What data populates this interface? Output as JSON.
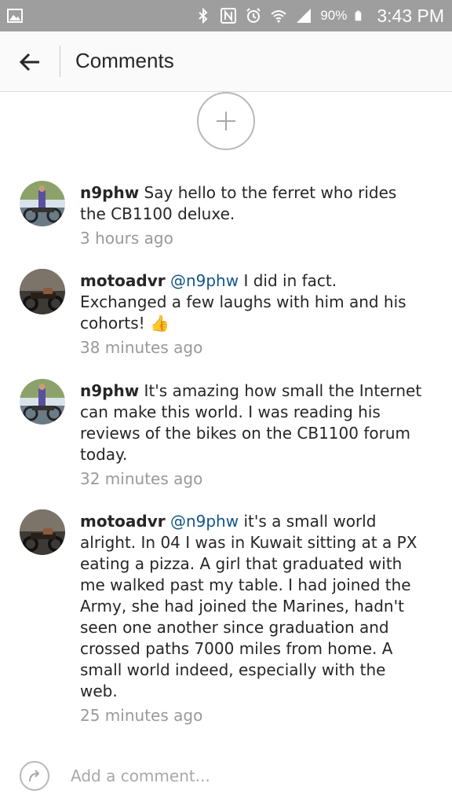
{
  "status_bar": {
    "battery_percent": "90%",
    "time": "3:43 PM",
    "icons": [
      "gallery-icon",
      "bluetooth-icon",
      "nfc-icon",
      "alarm-icon",
      "wifi-icon",
      "signal-icon",
      "battery-icon"
    ]
  },
  "header": {
    "title": "Comments",
    "back_icon": "back-arrow-icon"
  },
  "load_more": {
    "icon": "plus-icon"
  },
  "comments": [
    {
      "username": "n9phw",
      "mention": "",
      "text": "Say hello to the ferret who rides the CB1100 deluxe.",
      "timestamp": "3 hours ago",
      "avatar": "n9phw-avatar"
    },
    {
      "username": "motoadvr",
      "mention": "@n9phw",
      "text": "I did in fact. Exchanged a few laughs with him and his cohorts!",
      "emoji": "👍",
      "timestamp": "38 minutes ago",
      "avatar": "motoadvr-avatar"
    },
    {
      "username": "n9phw",
      "mention": "",
      "text": "It's amazing how small the Internet can make this world. I was reading his reviews of the bikes on the CB1100 forum today.",
      "timestamp": "32 minutes ago",
      "avatar": "n9phw-avatar"
    },
    {
      "username": "motoadvr",
      "mention": "@n9phw",
      "text": "it's a small world alright. In 04 I was in Kuwait sitting at a PX eating a pizza. A girl that graduated with me walked past my table. I had joined the Army, she had joined the Marines, hadn't seen one another since graduation and crossed paths 7000 miles from home. A small world indeed, especially with the web.",
      "timestamp": "25 minutes ago",
      "avatar": "motoadvr-avatar"
    }
  ],
  "composer": {
    "placeholder": "Add a comment...",
    "value": "",
    "icon": "share-icon"
  },
  "colors": {
    "status_bar_bg": "#9e9e9e",
    "mention": "#125688",
    "timestamp": "#999999",
    "text": "#262626"
  }
}
